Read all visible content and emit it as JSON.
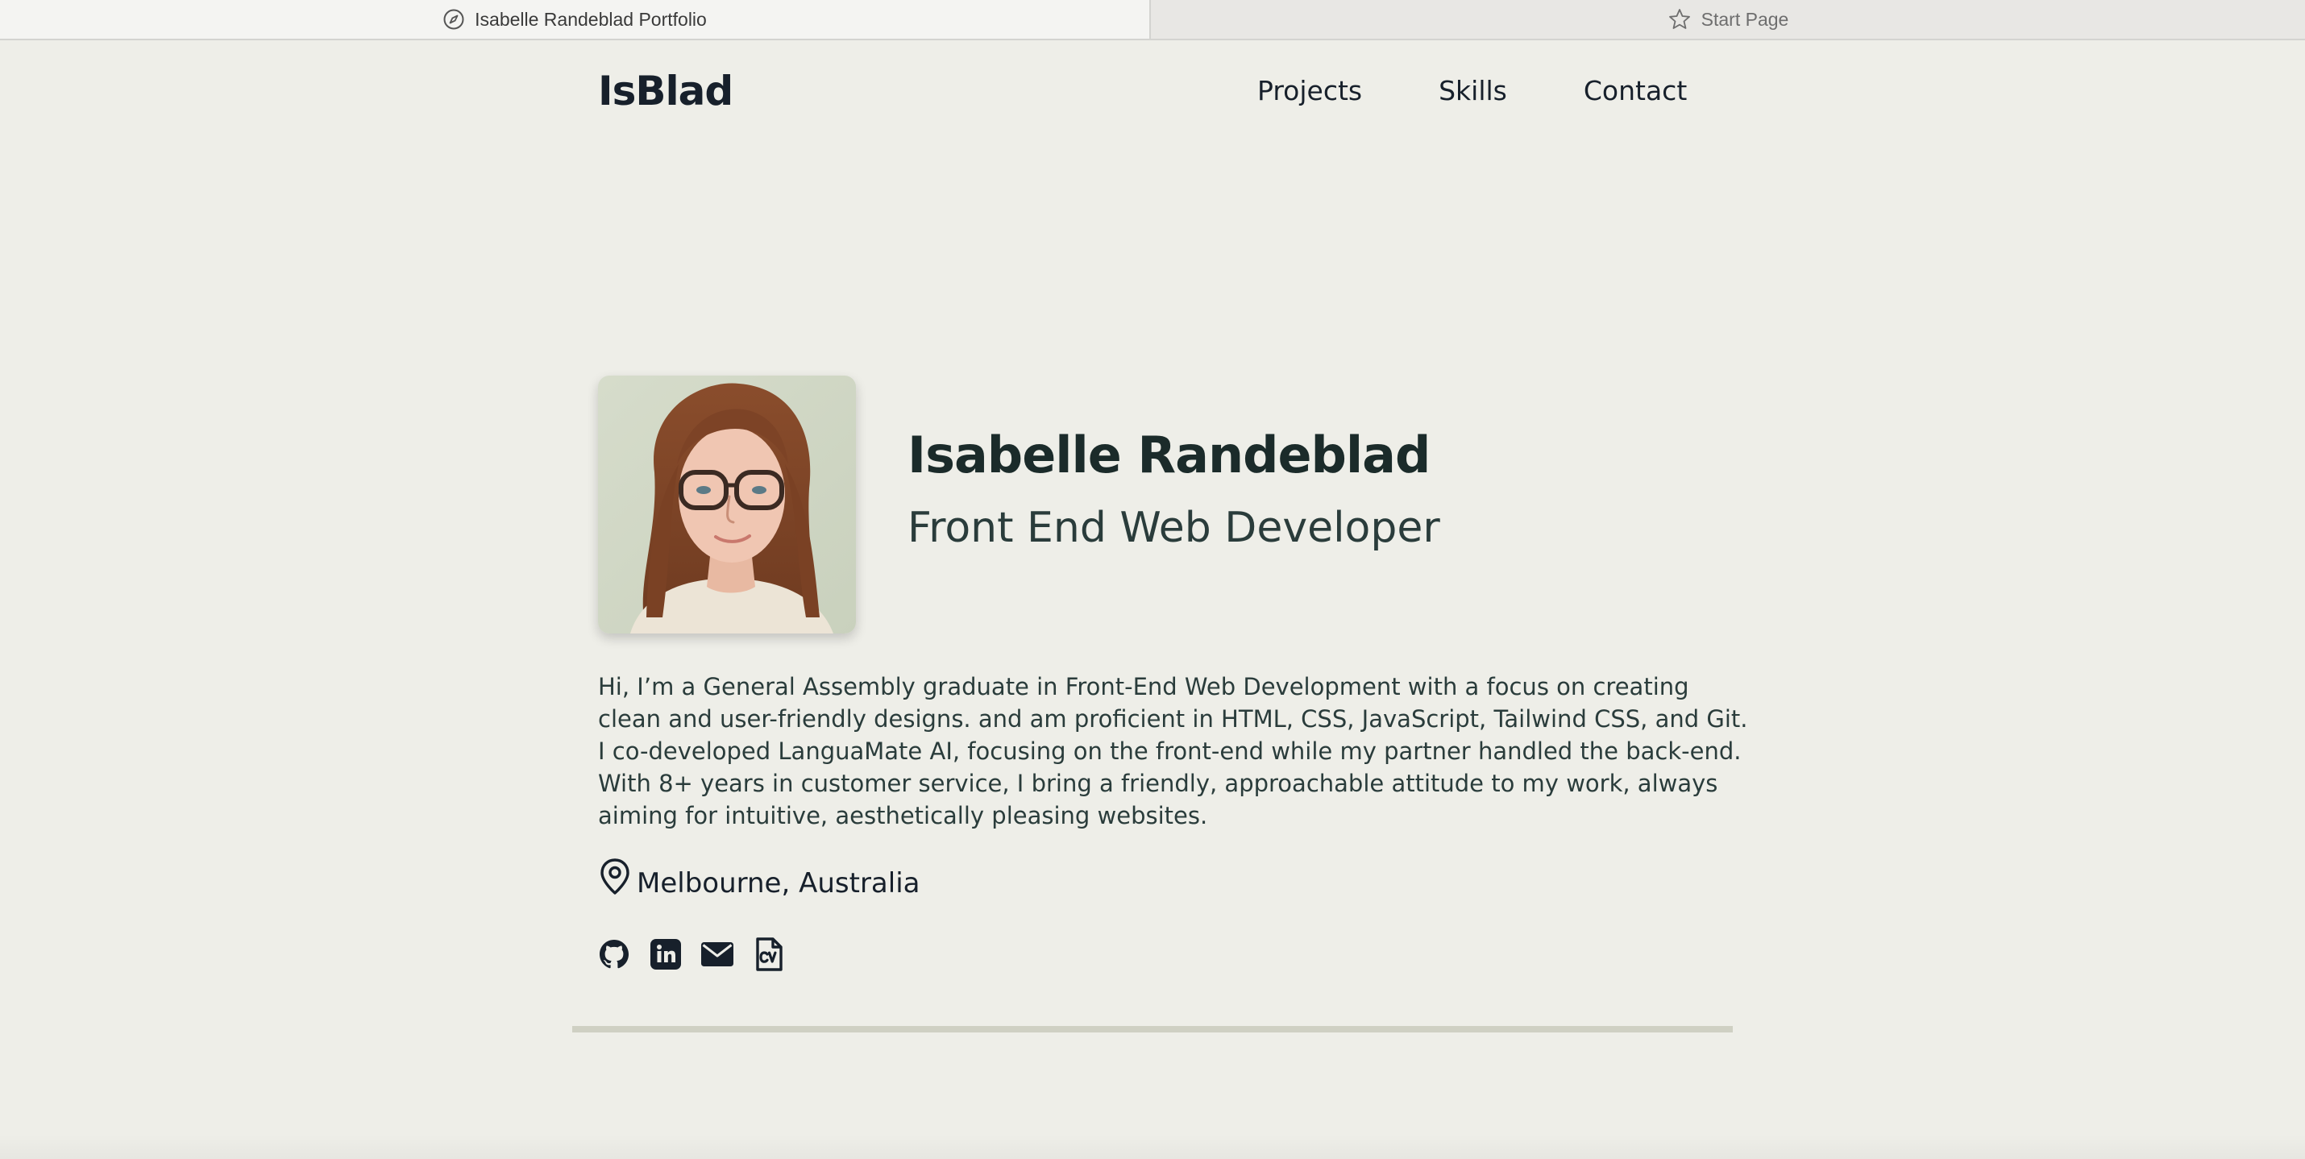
{
  "browser": {
    "tabs": [
      {
        "title": "Isabelle Randeblad Portfolio",
        "icon": "compass-icon",
        "active": true
      },
      {
        "title": "Start Page",
        "icon": "star-icon",
        "active": false
      }
    ]
  },
  "header": {
    "logo": "IsBlad",
    "nav": [
      "Projects",
      "Skills",
      "Contact"
    ]
  },
  "hero": {
    "name": "Isabelle Randeblad",
    "role": "Front End Web Developer",
    "bio_lines": [
      "Hi, I’m a General Assembly graduate in Front-End Web Development with a focus on creating",
      "clean and user-friendly designs. and am proficient in HTML, CSS, JavaScript, Tailwind CSS, and Git.",
      "I co-developed LanguaMate AI, focusing on the front-end while my partner handled the back-end.",
      "With 8+ years in customer service, I bring a friendly, approachable attitude to my work, always",
      "aiming for intuitive, aesthetically pleasing websites."
    ],
    "location": "Melbourne, Australia",
    "social_links": [
      {
        "icon": "github-icon"
      },
      {
        "icon": "linkedin-icon"
      },
      {
        "icon": "email-icon"
      },
      {
        "icon": "cv-file-icon"
      }
    ]
  },
  "colors": {
    "page_background": "#eeeee8",
    "heading_text": "#1b2b2a",
    "body_text": "#2a3c3b",
    "icon_dark": "#17202b",
    "divider": "#cfd0c3"
  }
}
